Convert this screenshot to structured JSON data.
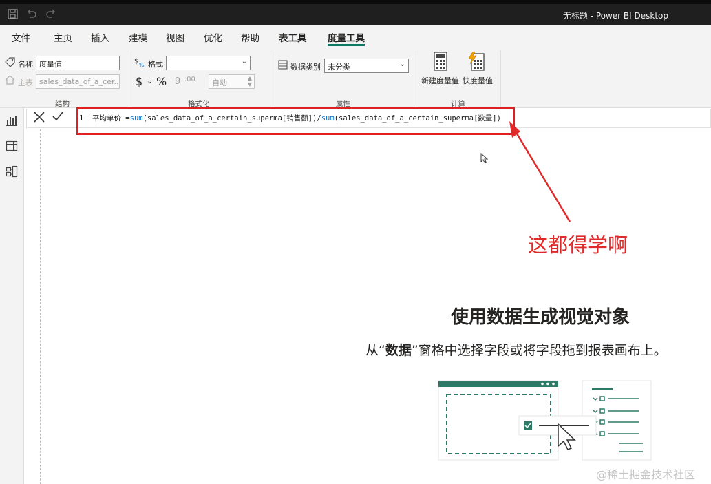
{
  "window": {
    "title": "无标题 - Power BI Desktop"
  },
  "menu": {
    "tabs": [
      "文件",
      "主页",
      "插入",
      "建模",
      "视图",
      "优化",
      "帮助",
      "表工具",
      "度量工具"
    ],
    "active_tab": "度量工具"
  },
  "ribbon": {
    "structure": {
      "name_label": "名称",
      "name_value": "度量值",
      "home_table_label": "主表",
      "home_table_value": "sales_data_of_a_cer...",
      "group_label": "结构"
    },
    "formatting": {
      "format_label": "格式",
      "format_value": "",
      "currency_symbol": "$",
      "percent_symbol": "%",
      "comma_symbol": "9",
      "decimal_symbol": ".00",
      "decimals_value": "自动",
      "group_label": "格式化"
    },
    "properties": {
      "data_category_label": "数据类别",
      "data_category_value": "未分类",
      "group_label": "属性"
    },
    "calculations": {
      "new_measure_label": "新建度量值",
      "quick_measure_label": "快度量值",
      "group_label": "计算"
    }
  },
  "formula_bar": {
    "line_number": "1",
    "measure_name": "平均单价",
    "equals": " =",
    "fn1": "sum",
    "arg1_table": "(sales_data_of_a_certain_superma",
    "arg1_col": "销售额",
    "divider": "])/",
    "fn2": "sum",
    "arg2_table": "(sales_data_of_a_certain_superma",
    "arg2_col": "数量",
    "close": "])"
  },
  "annotation": {
    "text": "这都得学啊",
    "color": "#e02a2a"
  },
  "empty_state": {
    "title": "使用数据生成视觉对象",
    "desc_prefix": "从“",
    "desc_bold": "数据",
    "desc_suffix": "”窗格中选择字段或将字段拖到报表画布上。"
  },
  "watermark": "@稀土掘金技术社区",
  "colors": {
    "accent": "#117865",
    "highlight_box": "#e02020"
  }
}
